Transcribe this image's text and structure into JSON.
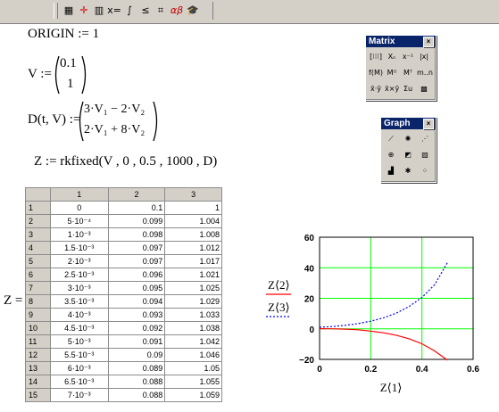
{
  "toolbar": {
    "buttons": [
      {
        "icon": "calculator-icon",
        "glyph": "▦"
      },
      {
        "icon": "graph-icon",
        "glyph": "✛"
      },
      {
        "icon": "matrix-icon",
        "glyph": "▥"
      },
      {
        "icon": "evaluation-icon",
        "glyph": "x="
      },
      {
        "icon": "calculus-icon",
        "glyph": "∫"
      },
      {
        "icon": "boolean-icon",
        "glyph": "≤"
      },
      {
        "icon": "programming-icon",
        "glyph": "⌗"
      },
      {
        "icon": "greek-icon",
        "glyph": "αβ"
      },
      {
        "icon": "symbolic-icon",
        "glyph": "🎓"
      }
    ]
  },
  "worksheet": {
    "origin": "ORIGIN := 1",
    "v_lhs": "V :=",
    "v_values": [
      "0.1",
      "1"
    ],
    "d_lhs": "D(t, V) :=",
    "d_rows": [
      "3·V₁ − 2·V₂",
      "2·V₁ + 8·V₂"
    ],
    "z_def": "Z := rkfixed(V , 0 , 0.5 , 1000 , D)",
    "z_eq": "Z ="
  },
  "table": {
    "columns": [
      "1",
      "2",
      "3"
    ],
    "rows": [
      {
        "n": "1",
        "c1": "0",
        "c2": "0.1",
        "c3": "1"
      },
      {
        "n": "2",
        "c1": "5·10⁻⁴",
        "c2": "0.099",
        "c3": "1.004"
      },
      {
        "n": "3",
        "c1": "1·10⁻³",
        "c2": "0.098",
        "c3": "1.008"
      },
      {
        "n": "4",
        "c1": "1.5·10⁻³",
        "c2": "0.097",
        "c3": "1.012"
      },
      {
        "n": "5",
        "c1": "2·10⁻³",
        "c2": "0.097",
        "c3": "1.017"
      },
      {
        "n": "6",
        "c1": "2.5·10⁻³",
        "c2": "0.096",
        "c3": "1.021"
      },
      {
        "n": "7",
        "c1": "3·10⁻³",
        "c2": "0.095",
        "c3": "1.025"
      },
      {
        "n": "8",
        "c1": "3.5·10⁻³",
        "c2": "0.094",
        "c3": "1.029"
      },
      {
        "n": "9",
        "c1": "4·10⁻³",
        "c2": "0.093",
        "c3": "1.033"
      },
      {
        "n": "10",
        "c1": "4.5·10⁻³",
        "c2": "0.092",
        "c3": "1.038"
      },
      {
        "n": "11",
        "c1": "5·10⁻³",
        "c2": "0.091",
        "c3": "1.042"
      },
      {
        "n": "12",
        "c1": "5.5·10⁻³",
        "c2": "0.09",
        "c3": "1.046"
      },
      {
        "n": "13",
        "c1": "6·10⁻³",
        "c2": "0.089",
        "c3": "1.05"
      },
      {
        "n": "14",
        "c1": "6.5·10⁻³",
        "c2": "0.088",
        "c3": "1.055"
      },
      {
        "n": "15",
        "c1": "7·10⁻³",
        "c2": "0.088",
        "c3": "1.059"
      }
    ]
  },
  "matrix_palette": {
    "title": "Matrix",
    "close": "×",
    "buttons": [
      {
        "icon": "matrix-insert-icon",
        "glyph": "[⁝⁝⁝]"
      },
      {
        "icon": "subscript-icon",
        "glyph": "Xₙ"
      },
      {
        "icon": "inverse-icon",
        "glyph": "x⁻¹"
      },
      {
        "icon": "determinant-icon",
        "glyph": "|x|"
      },
      {
        "icon": "vectorize-icon",
        "glyph": "f(M)"
      },
      {
        "icon": "column-icon",
        "glyph": "M⁽⁾"
      },
      {
        "icon": "transpose-icon",
        "glyph": "Mᵀ"
      },
      {
        "icon": "range-variable-icon",
        "glyph": "m..n"
      },
      {
        "icon": "dot-product-icon",
        "glyph": "x̄·ȳ"
      },
      {
        "icon": "cross-product-icon",
        "glyph": "x̄×ȳ"
      },
      {
        "icon": "vector-sum-icon",
        "glyph": "Σu"
      },
      {
        "icon": "picture-icon",
        "glyph": "▩"
      }
    ]
  },
  "graph_palette": {
    "title": "Graph",
    "close": "×",
    "buttons": [
      {
        "icon": "xy-plot-icon",
        "glyph": "⟋"
      },
      {
        "icon": "polar-plot-icon",
        "glyph": "✺"
      },
      {
        "icon": "surface-plot-icon",
        "glyph": "⋰"
      },
      {
        "icon": "polar-graph-icon",
        "glyph": "⊕"
      },
      {
        "icon": "contour-plot-icon",
        "glyph": "◩"
      },
      {
        "icon": "3d-scatter-icon",
        "glyph": "▨"
      },
      {
        "icon": "3d-bar-icon",
        "glyph": "▟"
      },
      {
        "icon": "vector-field-icon",
        "glyph": "✱"
      },
      {
        "icon": "scatter-plot-icon",
        "glyph": "⁘"
      }
    ]
  },
  "chart_data": {
    "type": "line",
    "xlabel": "Z⟨1⟩",
    "x_ticks": [
      "0",
      "0.2",
      "0.4",
      "0.6"
    ],
    "y_ticks": [
      "60",
      "40",
      "20",
      "0",
      "−20"
    ],
    "xlim": [
      0,
      0.6
    ],
    "ylim": [
      -20,
      60
    ],
    "grid": true,
    "legend": [
      {
        "label": "Z⟨2⟩",
        "color": "#ff0000",
        "style": "solid"
      },
      {
        "label": "Z⟨3⟩",
        "color": "#0000ff",
        "style": "dotted"
      }
    ],
    "series": [
      {
        "name": "Z⟨2⟩",
        "color": "#ff0000",
        "x": [
          0,
          0.05,
          0.1,
          0.15,
          0.2,
          0.25,
          0.3,
          0.35,
          0.4,
          0.45,
          0.5
        ],
        "y": [
          0.1,
          0.05,
          -0.2,
          -0.6,
          -1.5,
          -2.6,
          -4.2,
          -6.5,
          -9.8,
          -14.5,
          -20.5
        ]
      },
      {
        "name": "Z⟨3⟩",
        "color": "#0000ff",
        "x": [
          0,
          0.05,
          0.1,
          0.15,
          0.2,
          0.25,
          0.3,
          0.35,
          0.4,
          0.45,
          0.5
        ],
        "y": [
          1,
          1.5,
          2.3,
          3.4,
          5.0,
          7.2,
          10.3,
          14.6,
          20.5,
          29.0,
          43.5
        ]
      }
    ],
    "colors": {
      "grid": "#00ff00",
      "axis": "#000000"
    }
  }
}
